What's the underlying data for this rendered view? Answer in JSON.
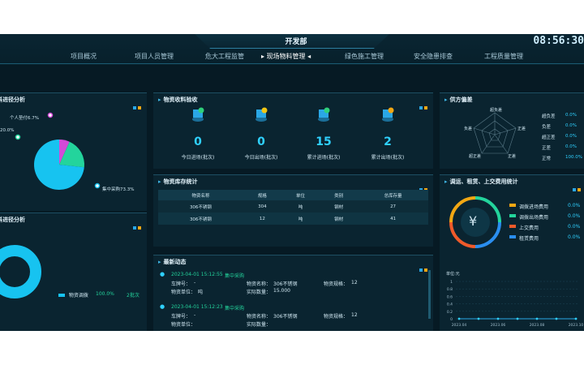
{
  "header": {
    "title": "开发部",
    "time": "08:56:30"
  },
  "nav": [
    {
      "label": "项目概况"
    },
    {
      "label": "项目人员管理"
    },
    {
      "label": "危大工程监管"
    },
    {
      "label": "现场物料管理"
    },
    {
      "label": "绿色施工管理"
    },
    {
      "label": "安全隐患排查"
    },
    {
      "label": "工程质量管理"
    }
  ],
  "panels": {
    "supply_pie": {
      "title": "料进径分析",
      "labels": [
        "个人垫付6.7%",
        "20.0%",
        "集中采购73.3%"
      ],
      "chart_data": {
        "type": "pie",
        "categories": [
          "个人垫付",
          "",
          "集中采购"
        ],
        "values": [
          6.7,
          20.0,
          73.3
        ],
        "colors": [
          "#d44ad8",
          "#23d49c",
          "#17c3f0"
        ]
      }
    },
    "material_pie": {
      "title": "料进径分析",
      "legend": {
        "name": "物资调拨",
        "pct": "100.0%",
        "count": "2批次"
      },
      "chart_data": {
        "type": "pie",
        "categories": [
          "物资调拨"
        ],
        "values": [
          100.0
        ],
        "colors": [
          "#17c3f0"
        ]
      }
    },
    "receiving": {
      "title": "物资收料验收",
      "stats": [
        {
          "value": "0",
          "label": "今日进场(批次)"
        },
        {
          "value": "0",
          "label": "今日出场(批次)"
        },
        {
          "value": "15",
          "label": "累计进场(批次)"
        },
        {
          "value": "2",
          "label": "累计出场(批次)"
        }
      ]
    },
    "inventory": {
      "title": "物资库存统计",
      "columns": [
        "物资名称",
        "规格",
        "单位",
        "类别",
        "总库存量"
      ],
      "rows": [
        [
          "306不锈钢",
          "304",
          "吨",
          "钢材",
          "27"
        ],
        [
          "306不锈钢",
          "12",
          "吨",
          "钢材",
          "41"
        ]
      ]
    },
    "news": {
      "title": "最新动态",
      "items": [
        {
          "time": "2023-04-01 15:12:55",
          "type": "集中采购",
          "plate_label": "车牌号：",
          "plate": "-",
          "name_label": "物资名称：",
          "name": "306不锈钢",
          "spec_label": "物资规格：",
          "spec": "12",
          "unit_label": "物资单位：",
          "unit": "吨",
          "qty_label": "实际数量：",
          "qty": "15.000"
        },
        {
          "time": "2023-04-01 15:12:23",
          "type": "集中采购",
          "plate_label": "车牌号：",
          "plate": "-",
          "name_label": "物资名称：",
          "name": "306不锈钢",
          "spec_label": "物资规格：",
          "spec": "12",
          "unit_label": "物资单位：",
          "unit": "",
          "qty_label": "实际数量：",
          "qty": ""
        }
      ]
    },
    "supplier": {
      "title": "供方偏差",
      "axes": [
        "超负差",
        "正差",
        "正差",
        "超正差",
        "负差"
      ],
      "legend": [
        {
          "name": "超负差",
          "value": "0.0%"
        },
        {
          "name": "负差",
          "value": "0.0%"
        },
        {
          "name": "超正差",
          "value": "0.0%"
        },
        {
          "name": "正差",
          "value": "0.0%"
        },
        {
          "name": "正常",
          "value": "100.0%"
        }
      ]
    },
    "costs": {
      "title": "调运、租赁、上交费用统计",
      "symbol": "¥",
      "legend": [
        {
          "name": "调拨进场费用",
          "value": "0.0%",
          "color": "#f2a713"
        },
        {
          "name": "调拨出场费用",
          "value": "0.0%",
          "color": "#23d49c"
        },
        {
          "name": "上交费用",
          "value": "0.0%",
          "color": "#f05a2a"
        },
        {
          "name": "租赁费用",
          "value": "0.0%",
          "color": "#2a8ef0"
        }
      ],
      "unit": "单位:元",
      "chart_data": {
        "type": "line",
        "x": [
          "2023.04",
          "2023.05",
          "2023.06",
          "2023.07",
          "2023.08",
          "2023.09",
          "2023.10"
        ],
        "series": [
          {
            "values": [
              0,
              0,
              0,
              0,
              0,
              0,
              0
            ]
          }
        ],
        "yticks": [
          "1",
          "0.8",
          "0.6",
          "0.4",
          "0.2",
          "0"
        ],
        "xticks": [
          "2023.04",
          "2023.06",
          "2023.08",
          "2023.10"
        ],
        "ylim": [
          0,
          1
        ]
      }
    }
  }
}
